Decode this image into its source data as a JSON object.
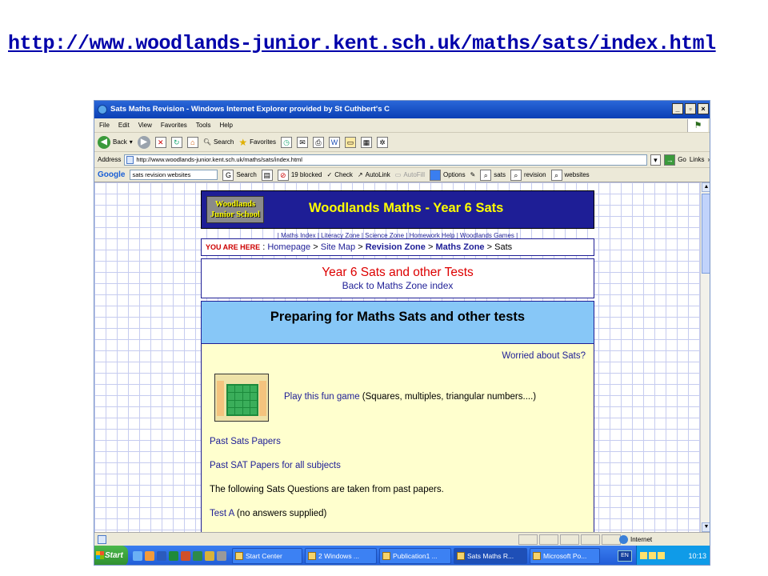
{
  "slide_link": "http://www.woodlands-junior.kent.sch.uk/maths/sats/index.html",
  "browser": {
    "title": "Sats Maths Revision - Windows Internet Explorer provided by St Cuthbert's C",
    "window_buttons": [
      "_",
      "▫",
      "×"
    ],
    "menu": [
      "File",
      "Edit",
      "View",
      "Favorites",
      "Tools",
      "Help"
    ],
    "toolbar": {
      "back": "Back",
      "search": "Search",
      "favorites": "Favorites"
    },
    "address_label": "Address",
    "address_value": "http://www.woodlands-junior.kent.sch.uk/maths/sats/index.html",
    "go": "Go",
    "links": "Links",
    "google": {
      "label": "Google",
      "query": "sats revision websites",
      "search": "Search",
      "blocked": "19 blocked",
      "check": "Check",
      "autolink": "AutoLink",
      "autofill": "AutoFill",
      "options": "Options",
      "terms": [
        "sats",
        "revision",
        "websites"
      ]
    },
    "status_zone": "Internet"
  },
  "taskbar": {
    "start": "Start",
    "items": [
      "Start Center",
      "2 Windows ...",
      "Publication1 ...",
      "Sats Maths R...",
      "Microsoft Po..."
    ],
    "lang": "EN",
    "clock": "10:13"
  },
  "page": {
    "logo": "Woodlands Junior School",
    "banner_title": "Woodlands Maths - Year 6 Sats",
    "nav_links": "| Maths Index | Literacy Zone | Science Zone | Homework Help | Woodlands Games |",
    "breadcrumb": {
      "here": "YOU ARE HERE",
      "sep": " : ",
      "items": [
        "Homepage",
        "Site Map",
        "Revision Zone",
        "Maths Zone",
        "Sats"
      ]
    },
    "heading": "Year 6 Sats and other Tests",
    "back_link": "Back to Maths Zone index",
    "section_title": "Preparing for Maths Sats and other tests",
    "worried": "Worried about Sats?",
    "play_link": "Play this fun game",
    "play_note": " (Squares, multiples, triangular numbers....)",
    "past_papers": "Past Sats Papers",
    "past_all": "Past SAT Papers for all subjects",
    "following": "The following Sats Questions are taken from past papers.",
    "test_a": "Test A",
    "test_a_note": " (no answers supplied)"
  }
}
